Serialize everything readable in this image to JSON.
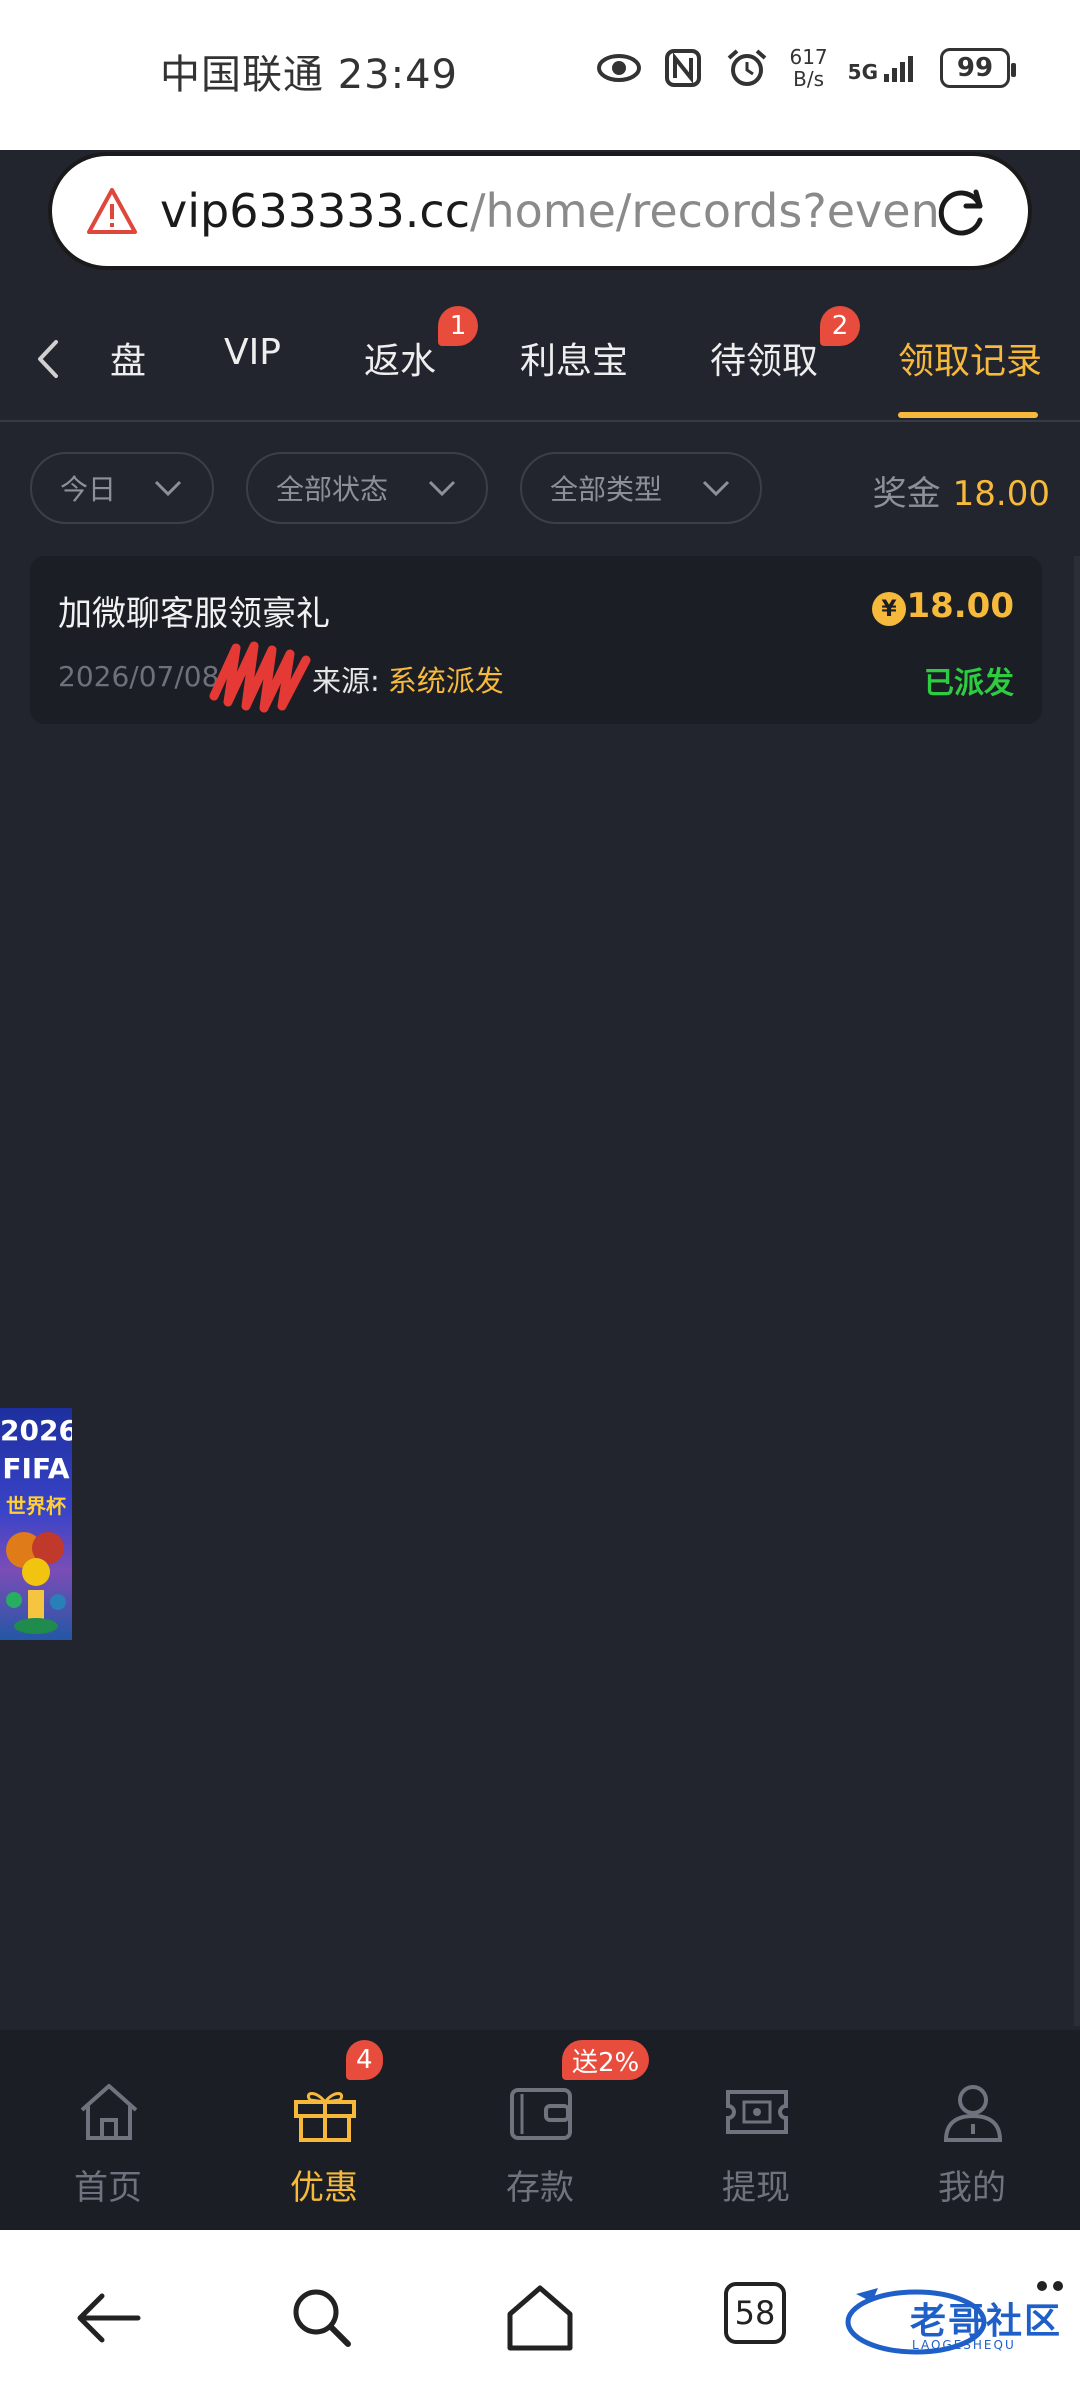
{
  "status_bar": {
    "carrier": "中国联通",
    "time": "23:49",
    "net_speed_value": "617",
    "net_speed_unit": "B/s",
    "signal": "5G",
    "battery": "99"
  },
  "browser": {
    "url_host": "vip633333.cc",
    "url_path": "/home/records?even"
  },
  "top_tabs": [
    {
      "label": "盘",
      "badge": ""
    },
    {
      "label": "VIP",
      "badge": ""
    },
    {
      "label": "返水",
      "badge": "1"
    },
    {
      "label": "利息宝",
      "badge": ""
    },
    {
      "label": "待领取",
      "badge": "2"
    },
    {
      "label": "领取记录",
      "badge": "",
      "active": true
    }
  ],
  "filters": {
    "date": "今日",
    "status": "全部状态",
    "type": "全部类型",
    "bonus_label": "奖金",
    "bonus_value": "18.00"
  },
  "records": [
    {
      "title": "加微聊客服领豪礼",
      "date": "2026/07/08",
      "source_label": "来源:",
      "source_value": "系统派发",
      "amount": "18.00",
      "currency_symbol": "¥",
      "status": "已派发"
    }
  ],
  "floating_banner": {
    "year": "2026",
    "brand": "FIFA",
    "subtitle": "世界杯"
  },
  "bottom_tabs": [
    {
      "label": "首页",
      "icon": "home-icon",
      "badge": ""
    },
    {
      "label": "优惠",
      "icon": "gift-icon",
      "badge": "4",
      "active": true
    },
    {
      "label": "存款",
      "icon": "wallet-icon",
      "badge": "送2%"
    },
    {
      "label": "提现",
      "icon": "cash-icon",
      "badge": ""
    },
    {
      "label": "我的",
      "icon": "user-icon",
      "badge": ""
    }
  ],
  "android_nav": {
    "tab_count": "58",
    "watermark_text": "老哥社区",
    "watermark_sub": "LAOGESHEQU"
  },
  "colors": {
    "accent": "#f6b93b",
    "background": "#22252d",
    "card": "#1b1e24",
    "badge": "#e74c3c",
    "success": "#2ecc40"
  }
}
